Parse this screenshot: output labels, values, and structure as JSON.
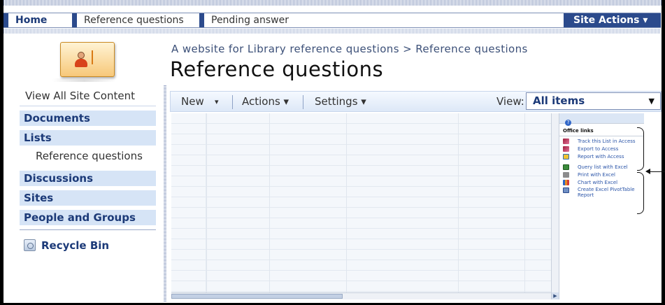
{
  "topnav": {
    "tabs": [
      {
        "label": "Home"
      },
      {
        "label": "Reference questions"
      },
      {
        "label": "Pending answer"
      }
    ],
    "site_actions": "Site Actions ▾"
  },
  "breadcrumb": "A website for Library reference questions > Reference questions",
  "page_title": "Reference questions",
  "quick_launch": {
    "view_all": "View All Site Content",
    "documents": "Documents",
    "lists": "Lists",
    "lists_item": "Reference questions",
    "discussions": "Discussions",
    "sites": "Sites",
    "people": "People and Groups",
    "recycle_bin": "Recycle Bin"
  },
  "toolbar": {
    "new": "New",
    "new_arrow": "▾",
    "actions": "Actions ▾",
    "settings": "Settings ▾",
    "view_label": "View:",
    "view_value": "All items",
    "view_arrow": "▼"
  },
  "task_pane": {
    "help": "?",
    "title": "Office links",
    "items": [
      {
        "label": "Track this List in Access",
        "icon": "access-icon"
      },
      {
        "label": "Export to Access",
        "icon": "access-icon"
      },
      {
        "label": "Report with Access",
        "icon": "report-icon"
      },
      {
        "label": "Query list with Excel",
        "icon": "excel-icon"
      },
      {
        "label": "Print with Excel",
        "icon": "print-icon"
      },
      {
        "label": "Chart with Excel",
        "icon": "chart-icon"
      },
      {
        "label": "Create Excel PivotTable Report",
        "icon": "pivot-icon"
      }
    ]
  },
  "colors": {
    "nav_blue": "#2b4a8c",
    "quicklaunch_bg": "#d6e4f6",
    "link_blue": "#2b55a8"
  }
}
